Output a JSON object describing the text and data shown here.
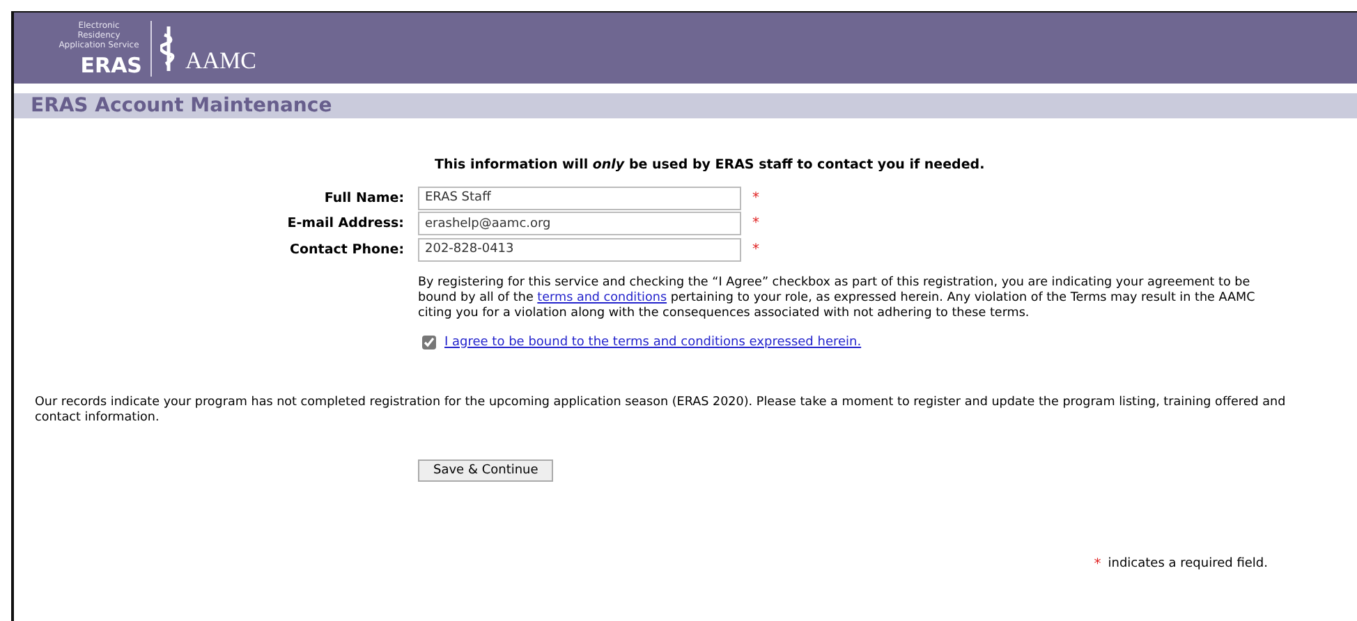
{
  "header": {
    "logo_tagline": "Electronic Residency Application Service",
    "logo_name": "ERAS",
    "logo_org": "AAMC"
  },
  "title_bar": {
    "title": "ERAS Account Maintenance"
  },
  "intro": "This information will *only* be used by ERAS staff to contact you if needed.",
  "fields": [
    {
      "label": "Full Name:",
      "value": "ERAS Staff",
      "required": true
    },
    {
      "label": "E-mail Address:",
      "value": "erashelp@aamc.org",
      "required": true
    },
    {
      "label": "Contact Phone:",
      "value": "202-828-0413",
      "required": true
    }
  ],
  "terms": {
    "before": "By registering for this service and checking the “I Agree” checkbox as part of this registration, you are indicating your agreement to be bound by all of the",
    "link": "terms and conditions",
    "after": "pertaining to your role, as expressed herein. Any violation of the Terms may result in the AAMC citing you for a violation along with the consequences associated with not adhering to these terms."
  },
  "agree": {
    "label": "I agree to be bound to the terms and conditions expressed herein.",
    "checked": true
  },
  "notice": "Our records indicate your program has not completed registration for the upcoming application season (ERAS 2020). Please take a moment to register and update the program listing, training offered and contact information.",
  "button": "Save & Continue",
  "required_note": {
    "mark": "*",
    "text": "indicates a required field."
  }
}
